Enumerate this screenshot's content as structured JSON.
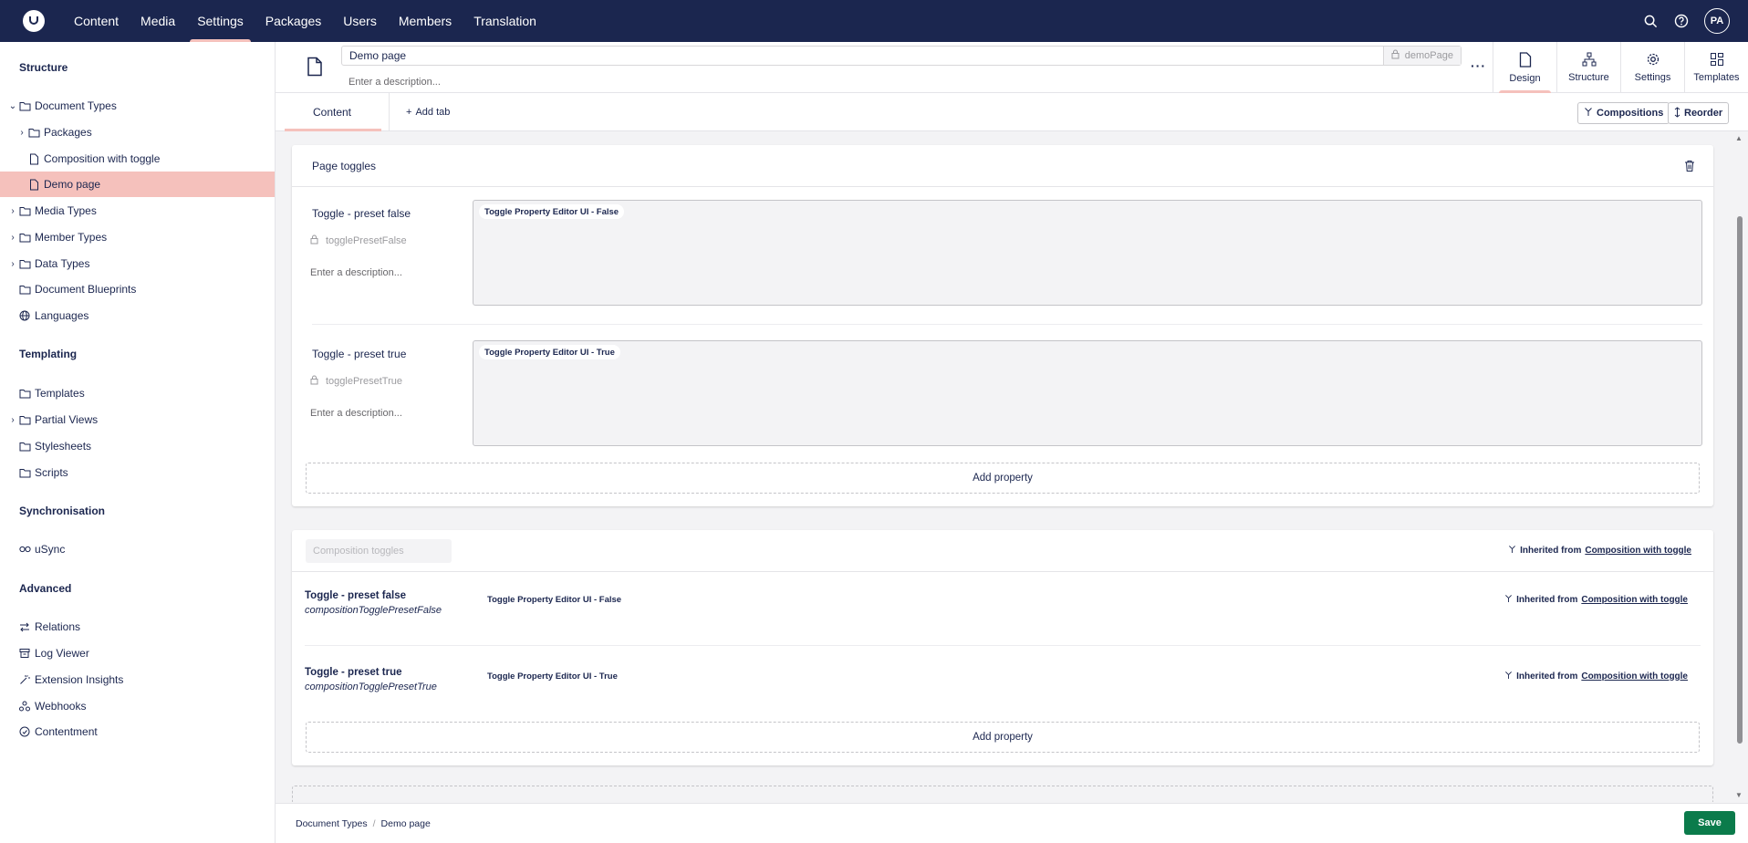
{
  "topnav": {
    "items": [
      "Content",
      "Media",
      "Settings",
      "Packages",
      "Users",
      "Members",
      "Translation"
    ],
    "active": "Settings",
    "user_initials": "PA"
  },
  "sidebar": {
    "sections": {
      "structure": "Structure",
      "templating": "Templating",
      "synchronisation": "Synchronisation",
      "advanced": "Advanced"
    },
    "structure_items": [
      {
        "label": "Document Types",
        "icon": "folder-icon",
        "expanded": true
      },
      {
        "label": "Packages",
        "icon": "folder-icon"
      },
      {
        "label": "Composition with toggle",
        "icon": "document-icon"
      },
      {
        "label": "Demo page",
        "icon": "document-icon",
        "active": true
      },
      {
        "label": "Media Types",
        "icon": "folder-icon"
      },
      {
        "label": "Member Types",
        "icon": "folder-icon"
      },
      {
        "label": "Data Types",
        "icon": "folder-icon"
      },
      {
        "label": "Document Blueprints",
        "icon": "folder-icon"
      },
      {
        "label": "Languages",
        "icon": "globe-icon"
      }
    ],
    "templating_items": [
      {
        "label": "Templates",
        "icon": "folder-icon"
      },
      {
        "label": "Partial Views",
        "icon": "folder-icon"
      },
      {
        "label": "Stylesheets",
        "icon": "folder-icon"
      },
      {
        "label": "Scripts",
        "icon": "folder-icon"
      }
    ],
    "sync_items": [
      {
        "label": "uSync",
        "icon": "infinity-icon"
      }
    ],
    "advanced_items": [
      {
        "label": "Relations",
        "icon": "relations-icon"
      },
      {
        "label": "Log Viewer",
        "icon": "archive-icon"
      },
      {
        "label": "Extension Insights",
        "icon": "wand-icon"
      },
      {
        "label": "Webhooks",
        "icon": "webhook-icon"
      },
      {
        "label": "Contentment",
        "icon": "contentment-icon"
      }
    ]
  },
  "header": {
    "name": "Demo page",
    "alias": "demoPage",
    "description_placeholder": "Enter a description...",
    "views": [
      "Design",
      "Structure",
      "Settings",
      "Templates"
    ],
    "active_view": "Design"
  },
  "tabs": {
    "content": "Content",
    "add_tab": "Add tab",
    "compositions": "Compositions",
    "reorder": "Reorder"
  },
  "group1": {
    "title": "Page toggles",
    "properties": [
      {
        "label": "Toggle - preset false",
        "alias": "togglePresetFalse",
        "description": "Enter a description...",
        "editor": "Toggle Property Editor UI - False"
      },
      {
        "label": "Toggle - preset true",
        "alias": "togglePresetTrue",
        "description": "Enter a description...",
        "editor": "Toggle Property Editor UI - True"
      }
    ],
    "add_property": "Add property"
  },
  "group2": {
    "title": "Composition toggles",
    "inherited_prefix": "Inherited from",
    "inherited_from": "Composition with toggle",
    "properties": [
      {
        "label": "Toggle - preset false",
        "alias": "compositionTogglePresetFalse",
        "editor": "Toggle Property Editor UI - False"
      },
      {
        "label": "Toggle - preset true",
        "alias": "compositionTogglePresetTrue",
        "editor": "Toggle Property Editor UI - True"
      }
    ],
    "add_property": "Add property"
  },
  "footer": {
    "breadcrumb": [
      "Document Types",
      "Demo page"
    ],
    "save": "Save"
  }
}
